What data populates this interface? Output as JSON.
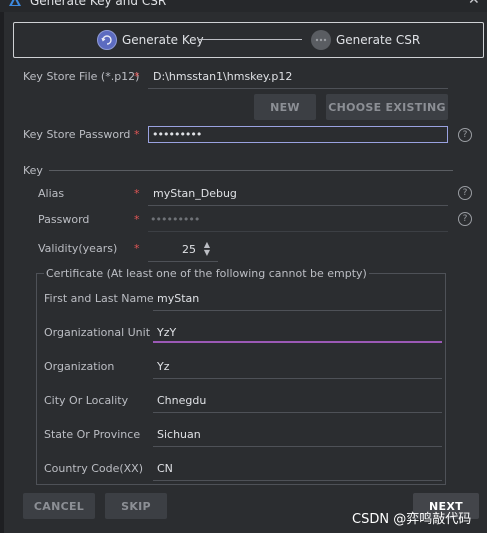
{
  "window": {
    "title": "Generate Key and CSR",
    "close_glyph": "✕"
  },
  "stepper": {
    "steps": [
      {
        "label": "Generate Key",
        "state": "active"
      },
      {
        "label": "Generate CSR",
        "state": "inactive"
      }
    ]
  },
  "keystore": {
    "file_label": "Key Store File (*.p12)",
    "file_value": "D:\\hmsstan1\\hmskey.p12",
    "new_button": "NEW",
    "choose_button": "CHOOSE EXISTING",
    "password_label": "Key Store Password",
    "password_value": "•••••••••",
    "required_mark": "*"
  },
  "key": {
    "section_label": "Key",
    "alias_label": "Alias",
    "alias_value": "myStan_Debug",
    "password_label": "Password",
    "password_value": "•••••••••",
    "validity_label": "Validity(years)",
    "validity_value": "25",
    "spinner_up": "▲",
    "spinner_down": "▼"
  },
  "certificate": {
    "title": "Certificate (At least one of the following cannot be empty)",
    "fields": [
      {
        "label": "First and Last Name",
        "value": "myStan"
      },
      {
        "label": "Organizational Unit",
        "value": "YzY"
      },
      {
        "label": "Organization",
        "value": "Yz"
      },
      {
        "label": "City Or Locality",
        "value": "Chnegdu"
      },
      {
        "label": "State Or Province",
        "value": "Sichuan"
      },
      {
        "label": "Country Code(XX)",
        "value": "CN"
      }
    ]
  },
  "footer": {
    "cancel": "CANCEL",
    "skip": "SKIP",
    "next": "NEXT"
  },
  "watermark": "CSDN @弈鸣敲代码",
  "icons": {
    "help": "?"
  },
  "colors": {
    "accent": "#5c6bc0",
    "required": "#e05555",
    "focus_underline": "#9b59b6",
    "background": "#2b2d30"
  }
}
